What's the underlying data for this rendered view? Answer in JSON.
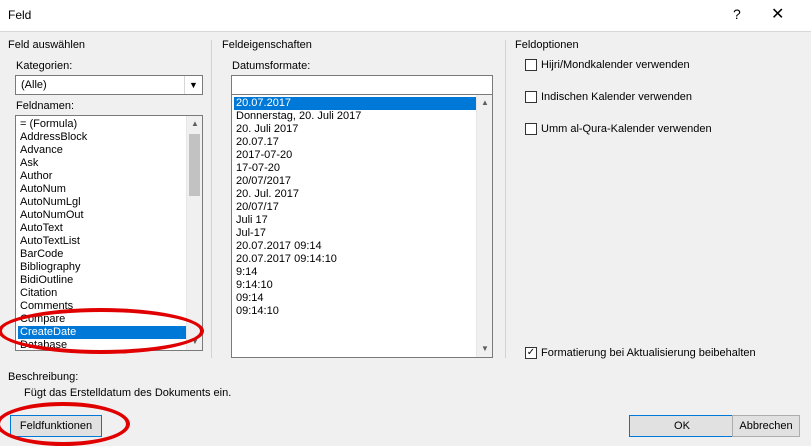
{
  "window": {
    "title": "Feld",
    "help": "?",
    "close": "✕"
  },
  "left": {
    "group": "Feld auswählen",
    "categories_label": "Kategorien:",
    "categories_value": "(Alle)",
    "names_label": "Feldnamen:",
    "names": [
      "= (Formula)",
      "AddressBlock",
      "Advance",
      "Ask",
      "Author",
      "AutoNum",
      "AutoNumLgl",
      "AutoNumOut",
      "AutoText",
      "AutoTextList",
      "BarCode",
      "Bibliography",
      "BidiOutline",
      "Citation",
      "Comments",
      "Compare",
      "CreateDate",
      "Database"
    ],
    "selected_name": "CreateDate"
  },
  "middle": {
    "group": "Feldeigenschaften",
    "formats_label": "Datumsformate:",
    "format_input": "",
    "formats": [
      "20.07.2017",
      "Donnerstag, 20. Juli 2017",
      "20. Juli 2017",
      "20.07.17",
      "2017-07-20",
      "17-07-20",
      "20/07/2017",
      "20. Jul. 2017",
      "20/07/17",
      "Juli 17",
      "Jul-17",
      "20.07.2017 09:14",
      "20.07.2017 09:14:10",
      "9:14",
      "9:14:10",
      "09:14",
      "09:14:10"
    ],
    "selected_format": "20.07.2017"
  },
  "right": {
    "group": "Feldoptionen",
    "options": [
      {
        "label": "Hijri/Mondkalender verwenden",
        "checked": false
      },
      {
        "label": "Indischen Kalender verwenden",
        "checked": false
      },
      {
        "label": "Umm al-Qura-Kalender verwenden",
        "checked": false
      }
    ],
    "keep_format": {
      "label": "Formatierung bei Aktualisierung beibehalten",
      "checked": true
    }
  },
  "description": {
    "label": "Beschreibung:",
    "text": "Fügt das Erstelldatum des Dokuments ein."
  },
  "buttons": {
    "field_codes": "Feldfunktionen",
    "ok": "OK",
    "cancel": "Abbrechen"
  },
  "annotations_color": "#e00000"
}
